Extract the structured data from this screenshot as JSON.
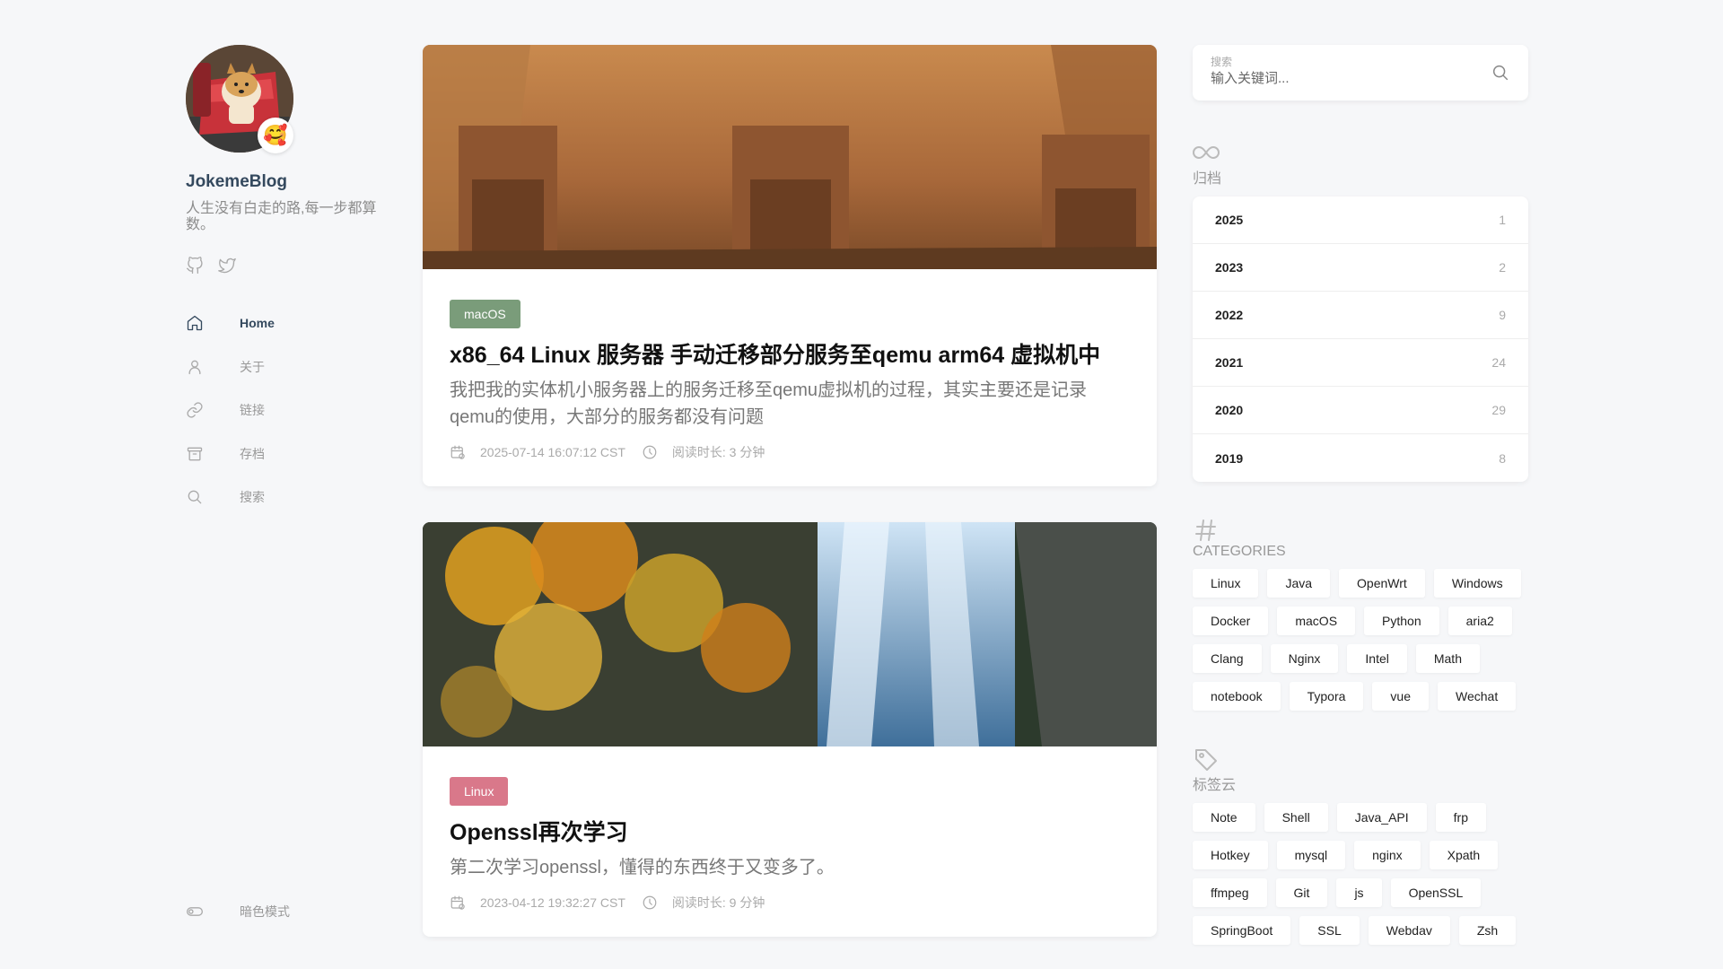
{
  "sidebar": {
    "site_name": "JokemeBlog",
    "site_desc": "人生没有白走的路,每一步都算数。",
    "avatar_emoji": "🥰",
    "nav": [
      {
        "label": "Home",
        "icon": "home-icon"
      },
      {
        "label": "关于",
        "icon": "user-icon"
      },
      {
        "label": "链接",
        "icon": "link-icon"
      },
      {
        "label": "存档",
        "icon": "archive-icon"
      },
      {
        "label": "搜索",
        "icon": "search-icon"
      }
    ],
    "dark_mode_label": "暗色模式"
  },
  "posts": [
    {
      "category": "macOS",
      "category_color": "#7a9c7a",
      "title": "x86_64 Linux 服务器 手动迁移部分服务至qemu arm64 虚拟机中",
      "summary": "我把我的实体机小服务器上的服务迁移至qemu虚拟机的过程，其实主要还是记录qemu的使用，大部分的服务都没有问题",
      "date": "2025-07-14 16:07:12 CST",
      "read_time": "阅读时长: 3 分钟"
    },
    {
      "category": "Linux",
      "category_color": "#d9788a",
      "title": "Openssl再次学习",
      "summary": "第二次学习openssl，懂得的东西终于又变多了。",
      "date": "2023-04-12 19:32:27 CST",
      "read_time": "阅读时长: 9 分钟"
    }
  ],
  "search": {
    "label": "搜索",
    "placeholder": "输入关键词..."
  },
  "archives": {
    "title": "归档",
    "items": [
      {
        "year": "2025",
        "count": "1"
      },
      {
        "year": "2023",
        "count": "2"
      },
      {
        "year": "2022",
        "count": "9"
      },
      {
        "year": "2021",
        "count": "24"
      },
      {
        "year": "2020",
        "count": "29"
      },
      {
        "year": "2019",
        "count": "8"
      }
    ]
  },
  "categories": {
    "title": "CATEGORIES",
    "items": [
      "Linux",
      "Java",
      "OpenWrt",
      "Windows",
      "Docker",
      "macOS",
      "Python",
      "aria2",
      "Clang",
      "Nginx",
      "Intel",
      "Math",
      "notebook",
      "Typora",
      "vue",
      "Wechat"
    ]
  },
  "tag_cloud": {
    "title": "标签云",
    "items": [
      "Note",
      "Shell",
      "Java_API",
      "frp",
      "Hotkey",
      "mysql",
      "nginx",
      "Xpath",
      "ffmpeg",
      "Git",
      "js",
      "OpenSSL",
      "SpringBoot",
      "SSL",
      "Webdav",
      "Zsh",
      "",
      "",
      "",
      ""
    ]
  }
}
